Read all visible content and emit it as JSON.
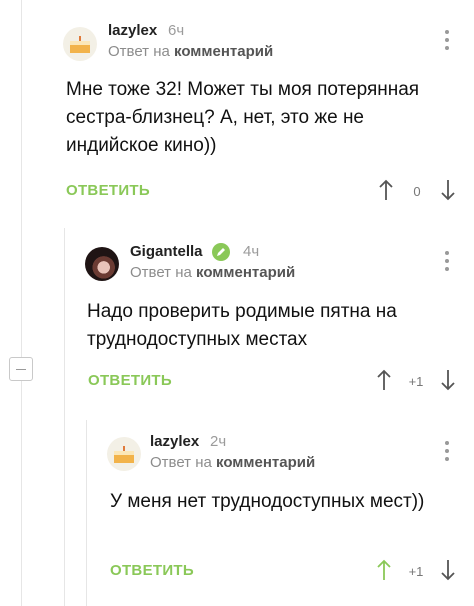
{
  "colors": {
    "accent": "#8ac858",
    "thread": "#e6e6e6",
    "muted": "#9b9b9b"
  },
  "comments": [
    {
      "username": "lazylex",
      "time": "6ч",
      "meta_prefix": "Ответ на",
      "meta_link": "комментарий",
      "text": "Мне тоже 32! Может ты моя потерянная сестра-близнец? А, нет, это же не индийское кино))",
      "reply_label": "ОТВЕТИТЬ",
      "rating": "0",
      "avatar_icon": "cake-avatar-icon"
    },
    {
      "username": "Gigantella",
      "time": "4ч",
      "meta_prefix": "Ответ на",
      "meta_link": "комментарий",
      "text": "Надо проверить родимые пятна на труднодоступных местах",
      "reply_label": "ОТВЕТИТЬ",
      "rating": "+1",
      "avatar_icon": "photo-avatar",
      "badge_icon": "pencil-icon"
    },
    {
      "username": "lazylex",
      "time": "2ч",
      "meta_prefix": "Ответ на",
      "meta_link": "комментарий",
      "text": "У меня нет труднодоступных мест))",
      "reply_label": "ОТВЕТИТЬ",
      "rating": "+1",
      "avatar_icon": "cake-avatar-icon",
      "upvoted": true
    }
  ]
}
